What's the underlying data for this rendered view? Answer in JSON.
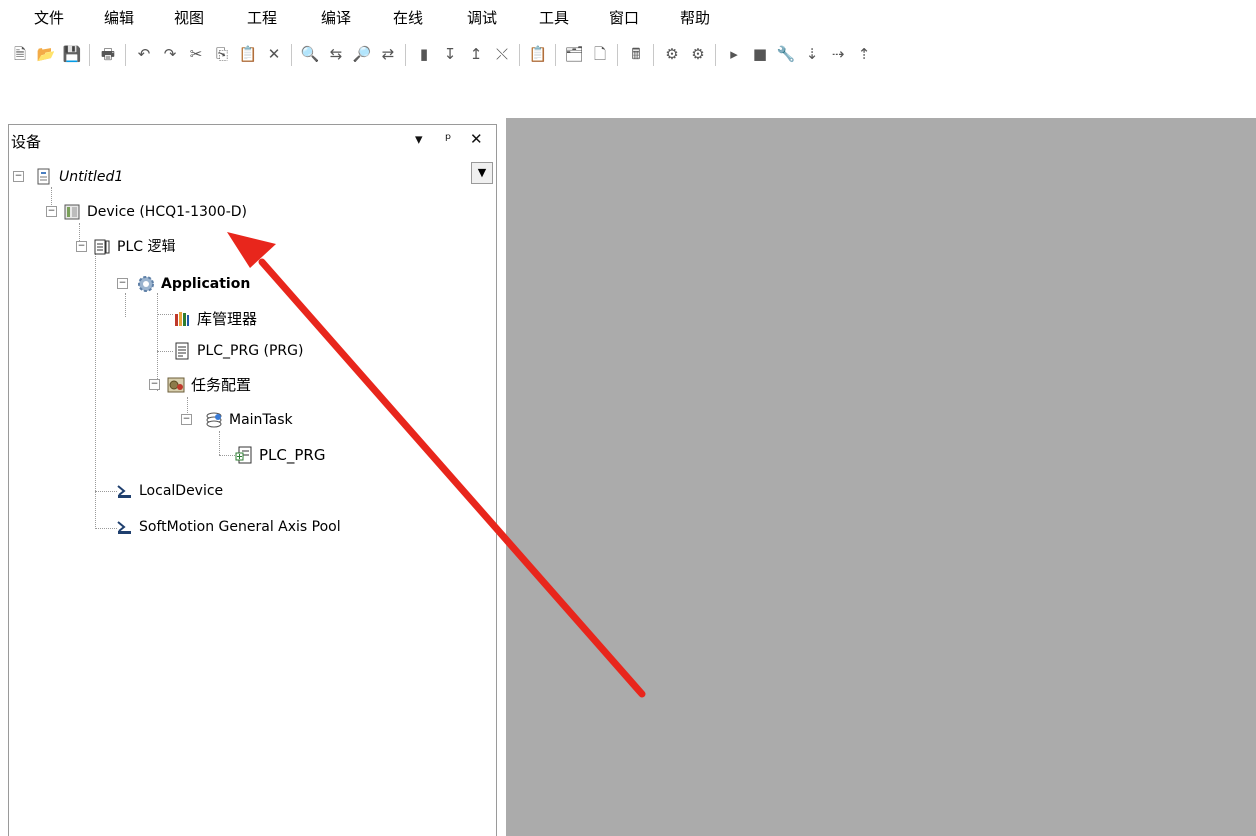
{
  "menu": [
    "文件",
    "编辑",
    "视图",
    "工程",
    "编译",
    "在线",
    "调试",
    "工具",
    "窗口",
    "帮助"
  ],
  "toolbar": {
    "icons": [
      "new-project-icon",
      "open-project-icon",
      "save-icon",
      "print-icon",
      "undo-icon",
      "redo-icon",
      "cut-icon",
      "copy-icon",
      "paste-icon",
      "delete-icon",
      "find-icon",
      "replace-icon",
      "find-next-icon",
      "find-previous-icon",
      "bookmark-icon",
      "bookmark-next-icon",
      "bookmark-previous-icon",
      "bookmark-clear-icon",
      "clipboard-icon",
      "add-object-icon",
      "add-folder-icon",
      "calculator-icon",
      "login-icon",
      "logout-icon",
      "run-icon",
      "stop-icon",
      "reset-icon",
      "step-over-icon",
      "step-into-icon",
      "step-out-icon"
    ],
    "glyphs": [
      "🗎",
      "📂",
      "💾",
      "🖶",
      "↶",
      "↷",
      "✂",
      "⎘",
      "📋",
      "✕",
      "🔍",
      "⇆",
      "🔎",
      "⇄",
      "▮",
      "↧",
      "↥",
      "⤬",
      "📋",
      "🗂",
      "🗋",
      "🖩",
      "⚙",
      "⚙",
      "▸",
      "■",
      "🔧",
      "⇣",
      "⇢",
      "⇡"
    ]
  },
  "panel": {
    "title": "设备",
    "dropdown_glyph": "▾",
    "pin_glyph": "ᵖ",
    "close_glyph": "✕",
    "tree_dropdown_glyph": "▼"
  },
  "tree": {
    "expander": "−",
    "root": "Untitled1",
    "device": "Device (HCQ1-1300-D)",
    "plc_logic": "PLC 逻辑",
    "application": "Application",
    "library_manager": "库管理器",
    "plc_prg": "PLC_PRG (PRG)",
    "task_config": "任务配置",
    "main_task": "MainTask",
    "task_prg": "PLC_PRG",
    "local_device": "LocalDevice",
    "axis_pool": "SoftMotion General Axis Pool"
  },
  "colors": {
    "editor_bg": "#ababab",
    "annotation_arrow": "#e8261c"
  }
}
